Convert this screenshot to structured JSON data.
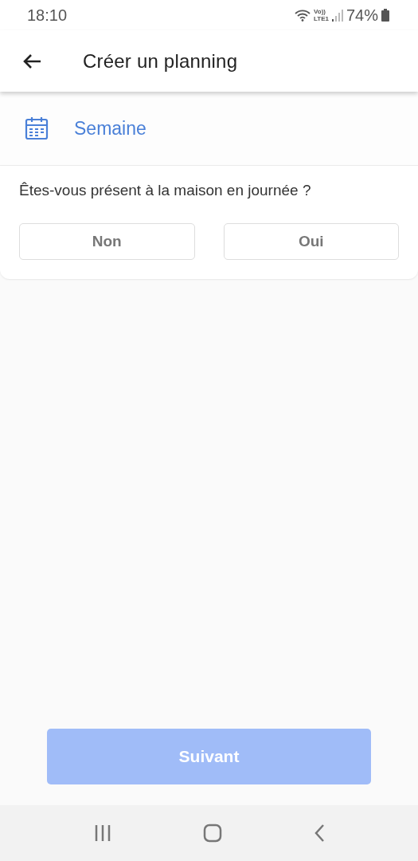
{
  "status_bar": {
    "time": "18:10",
    "network": [
      "Vo))",
      "LTE1"
    ],
    "battery": "74%"
  },
  "app_bar": {
    "title": "Créer un planning"
  },
  "period": {
    "label": "Semaine"
  },
  "question": {
    "text": "Êtes-vous présent à la maison en journée ?",
    "options": [
      {
        "label": "Non",
        "selected": false
      },
      {
        "label": "Oui",
        "selected": false
      }
    ]
  },
  "next_button": {
    "label": "Suivant",
    "disabled": true
  }
}
